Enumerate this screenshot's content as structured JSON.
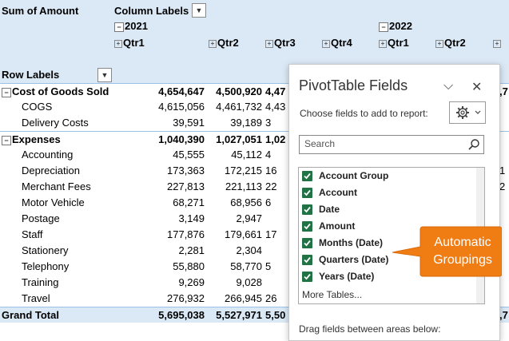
{
  "pivot": {
    "corner_label": "Sum of Amount",
    "column_labels": "Column Labels",
    "row_labels": "Row Labels",
    "years": [
      "2021",
      "2022"
    ],
    "quarters": [
      "Qtr1",
      "Qtr2",
      "Qtr3",
      "Qtr4",
      "Qtr1",
      "Qtr2"
    ],
    "rows": [
      {
        "label": "Cost of Goods Sold",
        "v1": "4,654,647",
        "v2": "4,500,920",
        "v3": "4,47",
        "edge": ",7",
        "bold": true
      },
      {
        "label": "COGS",
        "v1": "4,615,056",
        "v2": "4,461,732",
        "v3": "4,43",
        "edge": "",
        "bold": false
      },
      {
        "label": "Delivery Costs",
        "v1": "39,591",
        "v2": "39,189",
        "v3": "3",
        "edge": "",
        "bold": false
      },
      {
        "label": "Expenses",
        "v1": "1,040,390",
        "v2": "1,027,051",
        "v3": "1,02",
        "edge": "",
        "bold": true
      },
      {
        "label": "Accounting",
        "v1": "45,555",
        "v2": "45,112",
        "v3": "4",
        "edge": "",
        "bold": false
      },
      {
        "label": "Depreciation",
        "v1": "173,363",
        "v2": "172,215",
        "v3": "16",
        "edge": "1",
        "bold": false
      },
      {
        "label": "Merchant Fees",
        "v1": "227,813",
        "v2": "221,113",
        "v3": "22",
        "edge": "2",
        "bold": false
      },
      {
        "label": "Motor Vehicle",
        "v1": "68,271",
        "v2": "68,956",
        "v3": "6",
        "edge": "",
        "bold": false
      },
      {
        "label": "Postage",
        "v1": "3,149",
        "v2": "2,947",
        "v3": "",
        "edge": "",
        "bold": false
      },
      {
        "label": "Staff",
        "v1": "177,876",
        "v2": "179,661",
        "v3": "17",
        "edge": "",
        "bold": false
      },
      {
        "label": "Stationery",
        "v1": "2,281",
        "v2": "2,304",
        "v3": "",
        "edge": "",
        "bold": false
      },
      {
        "label": "Telephony",
        "v1": "55,880",
        "v2": "58,770",
        "v3": "5",
        "edge": "",
        "bold": false
      },
      {
        "label": "Training",
        "v1": "9,269",
        "v2": "9,028",
        "v3": "",
        "edge": "",
        "bold": false
      },
      {
        "label": "Travel",
        "v1": "276,932",
        "v2": "266,945",
        "v3": "26",
        "edge": "",
        "bold": false
      }
    ],
    "grand_total": {
      "label": "Grand Total",
      "v1": "5,695,038",
      "v2": "5,527,971",
      "v3": "5,50",
      "edge": ",7"
    }
  },
  "pane": {
    "title": "PivotTable Fields",
    "choose_label": "Choose fields to add to report:",
    "search_placeholder": "Search",
    "fields": [
      "Account Group",
      "Account",
      "Date",
      "Amount",
      "Months (Date)",
      "Quarters (Date)",
      "Years (Date)"
    ],
    "more_tables": "More Tables...",
    "drag_label": "Drag fields between areas below:",
    "check_color": "#217346"
  },
  "callout": {
    "line1": "Automatic",
    "line2": "Groupings",
    "color": "#f07c14"
  }
}
